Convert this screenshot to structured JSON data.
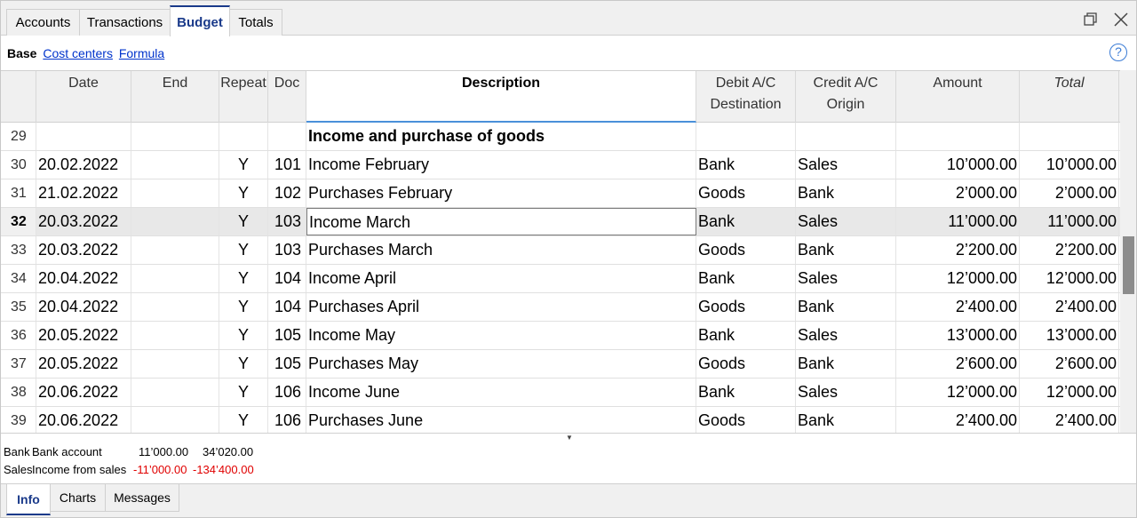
{
  "tabs": [
    "Accounts",
    "Transactions",
    "Budget",
    "Totals"
  ],
  "active_tab": "Budget",
  "views": {
    "active": "Base",
    "links": [
      "Cost centers",
      "Formula"
    ]
  },
  "help_label": "?",
  "columns": {
    "date": "Date",
    "end": "End",
    "repeat": "Repeat",
    "doc": "Doc",
    "description": "Description",
    "debit_line1": "Debit A/C",
    "debit_line2": "Destination",
    "credit_line1": "Credit A/C",
    "credit_line2": "Origin",
    "amount": "Amount",
    "total": "Total"
  },
  "rows": [
    {
      "num": "29",
      "date": "",
      "end": "",
      "repeat": "",
      "doc": "",
      "description": "Income and purchase of goods",
      "debit": "",
      "credit": "",
      "amount": "",
      "total": ""
    },
    {
      "num": "30",
      "date": "20.02.2022",
      "end": "",
      "repeat": "Y",
      "doc": "101",
      "description": "Income February",
      "debit": "Bank",
      "credit": "Sales",
      "amount": "10’000.00",
      "total": "10’000.00"
    },
    {
      "num": "31",
      "date": "21.02.2022",
      "end": "",
      "repeat": "Y",
      "doc": "102",
      "description": "Purchases February",
      "debit": "Goods",
      "credit": "Bank",
      "amount": "2’000.00",
      "total": "2’000.00"
    },
    {
      "num": "32",
      "date": "20.03.2022",
      "end": "",
      "repeat": "Y",
      "doc": "103",
      "description": "Income March",
      "debit": "Bank",
      "credit": "Sales",
      "amount": "11’000.00",
      "total": "11’000.00"
    },
    {
      "num": "33",
      "date": "20.03.2022",
      "end": "",
      "repeat": "Y",
      "doc": "103",
      "description": "Purchases March",
      "debit": "Goods",
      "credit": "Bank",
      "amount": "2’200.00",
      "total": "2’200.00"
    },
    {
      "num": "34",
      "date": "20.04.2022",
      "end": "",
      "repeat": "Y",
      "doc": "104",
      "description": "Income April",
      "debit": "Bank",
      "credit": "Sales",
      "amount": "12’000.00",
      "total": "12’000.00"
    },
    {
      "num": "35",
      "date": "20.04.2022",
      "end": "",
      "repeat": "Y",
      "doc": "104",
      "description": "Purchases April",
      "debit": "Goods",
      "credit": "Bank",
      "amount": "2’400.00",
      "total": "2’400.00"
    },
    {
      "num": "36",
      "date": "20.05.2022",
      "end": "",
      "repeat": "Y",
      "doc": "105",
      "description": "Income May",
      "debit": "Bank",
      "credit": "Sales",
      "amount": "13’000.00",
      "total": "13’000.00"
    },
    {
      "num": "37",
      "date": "20.05.2022",
      "end": "",
      "repeat": "Y",
      "doc": "105",
      "description": "Purchases May",
      "debit": "Goods",
      "credit": "Bank",
      "amount": "2’600.00",
      "total": "2’600.00"
    },
    {
      "num": "38",
      "date": "20.06.2022",
      "end": "",
      "repeat": "Y",
      "doc": "106",
      "description": "Income June",
      "debit": "Bank",
      "credit": "Sales",
      "amount": "12’000.00",
      "total": "12’000.00"
    },
    {
      "num": "39",
      "date": "20.06.2022",
      "end": "",
      "repeat": "Y",
      "doc": "106",
      "description": "Purchases June",
      "debit": "Goods",
      "credit": "Bank",
      "amount": "2’400.00",
      "total": "2’400.00"
    }
  ],
  "selected_row": "32",
  "info_lines": [
    {
      "account": "Bank",
      "name": "Bank account",
      "amount": "11’000.00",
      "balance": "34’020.00",
      "negative": false
    },
    {
      "account": "Sales",
      "name": "Income from sales",
      "amount": "-11’000.00",
      "balance": "-134’400.00",
      "negative": true
    }
  ],
  "bottom_tabs": [
    "Info",
    "Charts",
    "Messages"
  ],
  "active_bottom_tab": "Info",
  "colors": {
    "accent": "#1a3a8a",
    "link": "#0033cc",
    "negative": "#e00000",
    "selected_row": "#e8e8e8"
  },
  "icons": [
    "restore-window-icon",
    "close-icon",
    "help-icon",
    "splitter-arrow-icon"
  ]
}
